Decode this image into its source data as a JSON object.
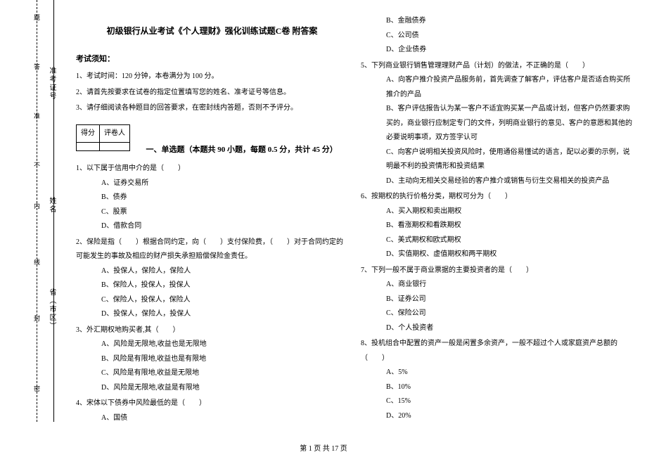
{
  "binding": {
    "chars": [
      "密",
      "封",
      "线",
      "内",
      "不",
      "准",
      "答",
      "题"
    ],
    "fields": {
      "province": "省（市区）",
      "name": "姓名",
      "admission": "准考证号"
    }
  },
  "title": "初级银行从业考试《个人理财》强化训练试题C卷 附答案",
  "notice_head": "考试须知：",
  "instructions": [
    "1、考试时间：120 分钟，本卷满分为 100 分。",
    "2、请首先按要求在试卷的指定位置填写您的姓名、准考证号等信息。",
    "3、请仔细阅读各种题目的回答要求，在密封线内答题，否则不予评分。"
  ],
  "score_table": {
    "c1": "得分",
    "c2": "评卷人"
  },
  "section1_title": "一、单选题（本题共 90 小题，每题 0.5 分，共计 45 分）",
  "col1": {
    "q1": "1、以下属于信用中介的是（　　）",
    "q1a": "A、证券交易所",
    "q1b": "B、债券",
    "q1c": "C、股票",
    "q1d": "D、借款合同",
    "q2": "2、保险是指（　　）根据合同约定，向（　　）支付保险费，（　　）对于合同约定的可能发生的事故及相应的财产损失承担赔偿保险金责任。",
    "q2a": "A、投保人，保险人，保险人",
    "q2b": "B、保险人，投保人，投保人",
    "q2c": "C、保险人，投保人，保险人",
    "q2d": "D、投保人，保险人，投保人",
    "q3": "3、外汇期权地购买者,其（　　）",
    "q3a": "A、风险是无限地,收益也是无限地",
    "q3b": "B、风险是有限地,收益也是有限地",
    "q3c": "C、风险是有限地,收益是无限地",
    "q3d": "D、风险是无限地,收益是有限地",
    "q4": "4、宋体以下债券中风险最低的是（　　）",
    "q4a": "A、国债"
  },
  "col2": {
    "q4b": "B、金融债券",
    "q4c": "C、公司债",
    "q4d": "D、企业债券",
    "q5": "5、下列商业银行销售管理理财产品（计划）的做法，不正确的是（　　）",
    "q5a": "A、向客户推介投资产品服务前，首先调查了解客户，评估客户是否适合购买所推介的产品",
    "q5b": "B、客户评估报告认为某一客户不适宜购买某一产品或计划，但客户仍然要求购买的，商业银行应制定专门的文件，列明商业银行的意见、客户的意愿和其他的必要说明事项，双方签字认可",
    "q5c": "C、向客户说明相关投资风险时，使用通俗易懂试的语言，配以必要的示例，说明最不利的投资情形和投资结果",
    "q5d": "D、主动向无相关交易经验的客户推介或销售与衍生交易相关的投资产品",
    "q6": "6、按期权的执行价格分类，期权可分为（　　）",
    "q6a": "A、买入期权和卖出期权",
    "q6b": "B、看涨期权和看跌期权",
    "q6c": "C、美式期权和欧式期权",
    "q6d": "D、实值期权、虚值期权和两平期权",
    "q7": "7、下列一般不属于商业票据的主要投资者的是（　　）",
    "q7a": "A、商业银行",
    "q7b": "B、证券公司",
    "q7c": "C、保险公司",
    "q7d": "D、个人投资者",
    "q8": "8、投机组合中配置的资产一般是闲置多余资产，一般不超过个人或家庭资产总额的（　　）",
    "q8a": "A、5%",
    "q8b": "B、10%",
    "q8c": "C、15%",
    "q8d": "D、20%"
  },
  "footer": "第 1 页 共 17 页"
}
